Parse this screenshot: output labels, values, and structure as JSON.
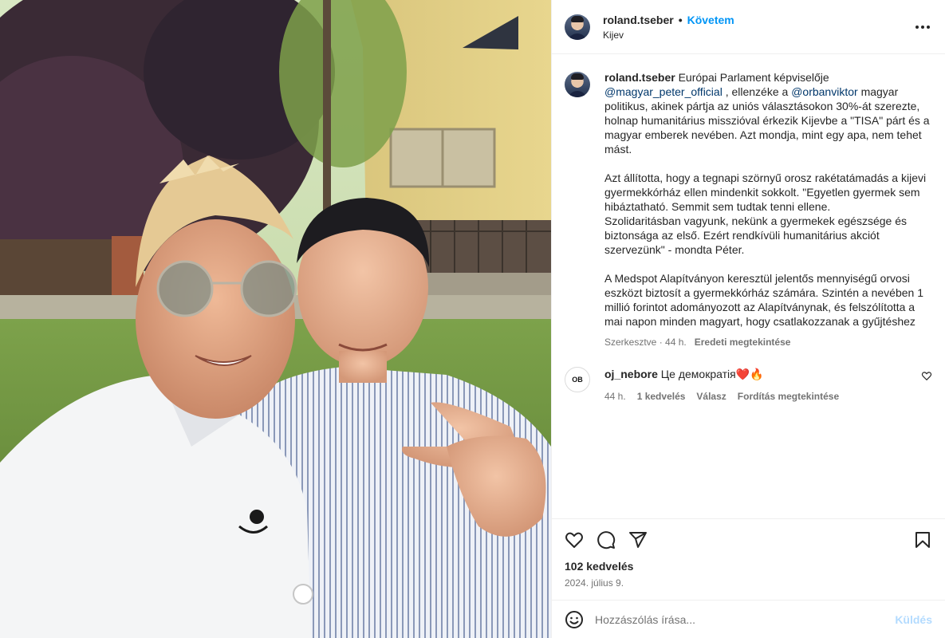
{
  "header": {
    "username": "roland.tseber",
    "separator": "•",
    "follow_label": "Követem",
    "location": "Kijev",
    "more_icon": "more-horizontal-icon"
  },
  "caption": {
    "username": "roland.tseber",
    "p1_a": "Európai Parlament képviselője",
    "p1_mention1": "@magyar_peter_official",
    "p1_b": ", ellenzéke a",
    "p1_mention2": "@orbanviktor",
    "p1_c": "magyar politikus, akinek pártja az uniós választásokon 30%-át szerezte, holnap humanitárius misszióval érkezik Kijevbe a \"TISA\" párt és a magyar emberek nevében. Azt mondja, mint egy apa, nem tehet mást.",
    "p2": "Azt állította, hogy a tegnapi szörnyű orosz rakétatámadás a kijevi gyermekkórház ellen mindenkit sokkolt. \"Egyetlen gyermek sem hibáztatható. Semmit sem tudtak tenni ellene.",
    "p3": "Szolidaritásban vagyunk, nekünk a gyermekek egészsége és biztonsága az első. Ezért rendkívüli humanitárius akciót szervezünk\" - mondta Péter.",
    "p4": "A Medspot Alapítványon keresztül jelentős mennyiségű orvosi eszközt biztosít a gyermekkórház számára. Szintén a nevében 1 millió forintot adományozott az Alapítványnak, és felszólította a mai napon minden magyart, hogy csatlakozzanak a gyűjtéshez",
    "edited": "Szerkesztve · 44 h.",
    "see_original": "Eredeti megtekintése"
  },
  "comments": [
    {
      "username": "oj_nebore",
      "avatar_text": "OB",
      "text": "Це демократія",
      "emoji": "❤️🔥",
      "time": "44 h.",
      "likes": "1 kedvelés",
      "reply": "Válasz",
      "translate": "Fordítás megtekintése"
    }
  ],
  "actions": {
    "icons": [
      "heart-icon",
      "comment-icon",
      "share-icon",
      "bookmark-icon"
    ]
  },
  "likes": "102 kedvelés",
  "date": "2024. július 9.",
  "add_comment": {
    "placeholder": "Hozzászólás írása...",
    "post_label": "Küldés"
  },
  "colors": {
    "link": "#0095f6",
    "mention": "#00376b",
    "muted": "#737373",
    "text": "#262626"
  }
}
